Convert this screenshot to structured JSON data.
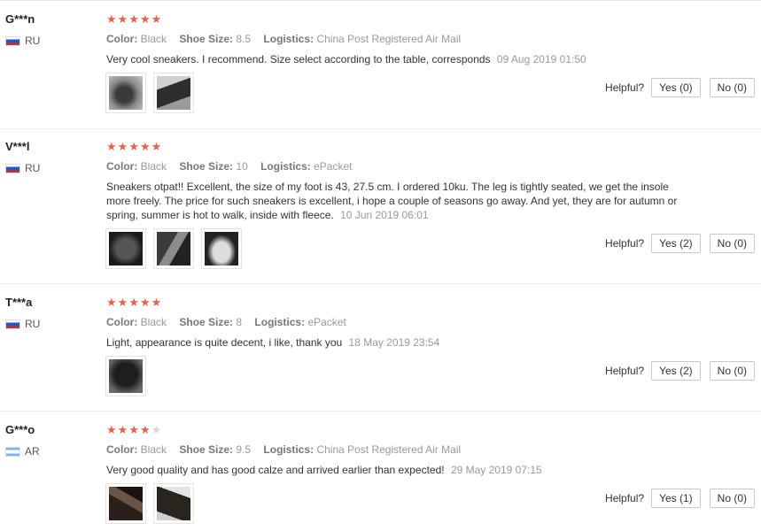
{
  "reviews": [
    {
      "user": "G***n",
      "country": "RU",
      "flag": "flag-ru",
      "stars": 5,
      "color_label": "Color:",
      "color": "Black",
      "size_label": "Shoe Size:",
      "size": "8.5",
      "logistics_label": "Logistics:",
      "logistics": "China Post Registered Air Mail",
      "text": "Very cool sneakers. I recommend. Size select according to the table, corresponds",
      "date": "09 Aug 2019 01:50",
      "photo_count": 2,
      "helpful_label": "Helpful?",
      "yes": "Yes (0)",
      "no": "No (0)"
    },
    {
      "user": "V***l",
      "country": "RU",
      "flag": "flag-ru",
      "stars": 5,
      "color_label": "Color:",
      "color": "Black",
      "size_label": "Shoe Size:",
      "size": "10",
      "logistics_label": "Logistics:",
      "logistics": "ePacket",
      "text": "Sneakers otpat!! Excellent, the size of my foot is 43, 27.5 cm. I ordered 10ku. The leg is tightly seated, we get the insole more freely. The price for such sneakers is excellent, i hope a couple of seasons go away. And yet, they are for autumn or spring, summer is hot to walk, inside with fleece.",
      "date": "10 Jun 2019 06:01",
      "photo_count": 3,
      "helpful_label": "Helpful?",
      "yes": "Yes (2)",
      "no": "No (0)"
    },
    {
      "user": "T***a",
      "country": "RU",
      "flag": "flag-ru",
      "stars": 5,
      "color_label": "Color:",
      "color": "Black",
      "size_label": "Shoe Size:",
      "size": "8",
      "logistics_label": "Logistics:",
      "logistics": "ePacket",
      "text": "Light, appearance is quite decent, i like, thank you",
      "date": "18 May 2019 23:54",
      "photo_count": 1,
      "helpful_label": "Helpful?",
      "yes": "Yes (2)",
      "no": "No (0)"
    },
    {
      "user": "G***o",
      "country": "AR",
      "flag": "flag-ar",
      "stars": 4,
      "color_label": "Color:",
      "color": "Black",
      "size_label": "Shoe Size:",
      "size": "9.5",
      "logistics_label": "Logistics:",
      "logistics": "China Post Registered Air Mail",
      "text": "Very good quality and has good calze and arrived earlier than expected!",
      "date": "29 May 2019 07:15",
      "photo_count": 2,
      "helpful_label": "Helpful?",
      "yes": "Yes (1)",
      "no": "No (0)"
    }
  ],
  "colors": {
    "star": "#e2644a",
    "star_empty": "#d6d6d6",
    "muted": "#999999",
    "button_border": "#c9c9c9"
  },
  "icons": {
    "rating": "star-icon",
    "country": "flag-icon"
  }
}
